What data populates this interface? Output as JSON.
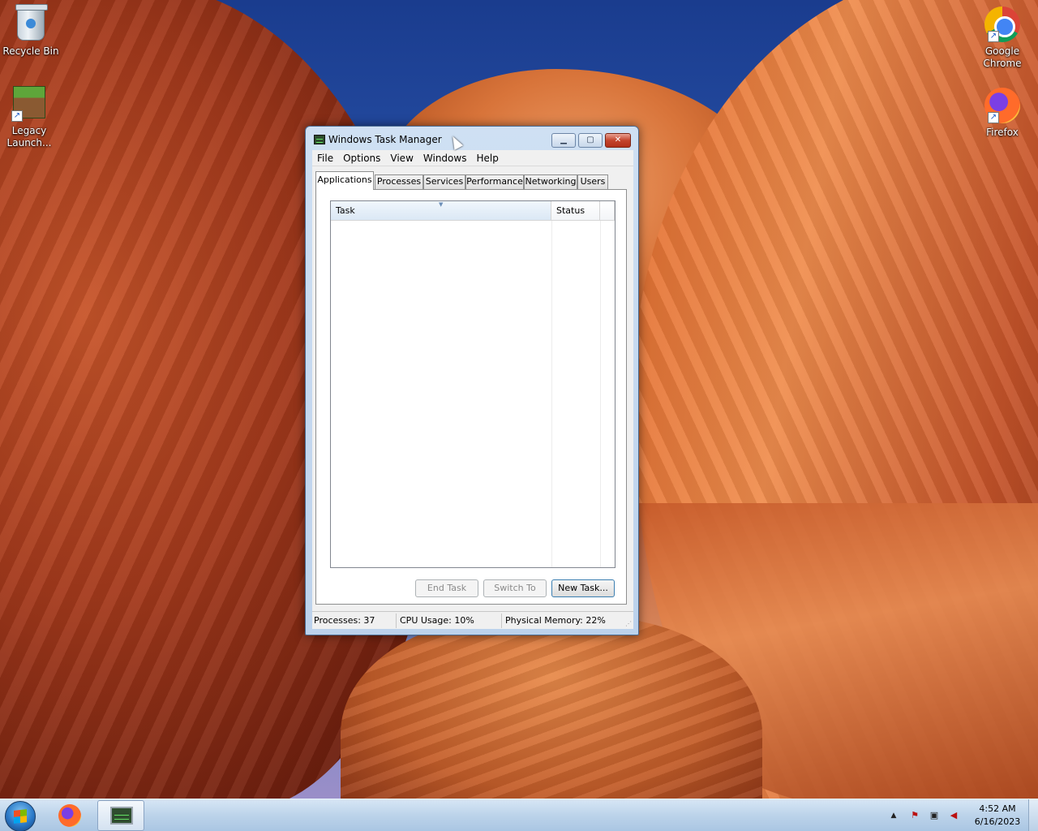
{
  "desktop": {
    "icons": [
      {
        "label": "Recycle Bin",
        "icon": "recycle-bin-icon"
      },
      {
        "label": "Legacy Launch...",
        "icon": "minecraft-grass-block-icon"
      },
      {
        "label": "Google Chrome",
        "icon": "chrome-icon"
      },
      {
        "label": "Firefox",
        "icon": "firefox-icon"
      }
    ]
  },
  "window": {
    "title": "Windows Task Manager",
    "title_icon": "task-manager-icon",
    "controls": {
      "minimize": "minimize-icon",
      "maximize": "maximize-icon",
      "close": "close-icon"
    },
    "menu": [
      "File",
      "Options",
      "View",
      "Windows",
      "Help"
    ],
    "tabs": [
      "Applications",
      "Processes",
      "Services",
      "Performance",
      "Networking",
      "Users"
    ],
    "active_tab": "Applications",
    "list": {
      "columns": [
        "Task",
        "Status"
      ],
      "rows": []
    },
    "buttons": {
      "end_task": "End Task",
      "switch_to": "Switch To",
      "new_task": "New Task..."
    },
    "status": {
      "processes": "Processes: 37",
      "cpu": "CPU Usage: 10%",
      "memory": "Physical Memory: 22%"
    }
  },
  "taskbar": {
    "pinned": [
      "firefox-icon",
      "task-manager-icon"
    ],
    "tray": [
      "show-hidden-icons",
      "action-center-flag-icon",
      "network-icon",
      "volume-muted-icon"
    ],
    "time": "4:52 AM",
    "date": "6/16/2023"
  },
  "colors": {
    "titlebar": "#cfe0f3",
    "close_button": "#c4452e",
    "taskbar": "#bcd3ea"
  }
}
